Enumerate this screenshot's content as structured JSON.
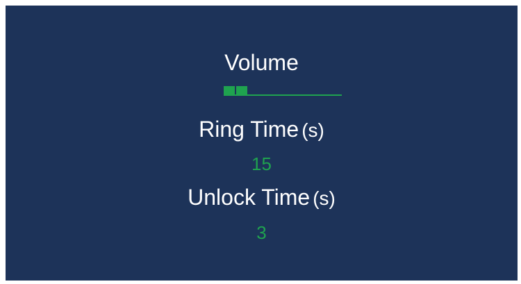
{
  "colors": {
    "background": "#1d3359",
    "label_text": "#ffffff",
    "accent": "#1fa34f"
  },
  "volume": {
    "label": "Volume",
    "level_blocks": 2,
    "level_fraction": 0.2
  },
  "ring_time": {
    "label": "Ring Time",
    "unit": "(s)",
    "value": "15"
  },
  "unlock_time": {
    "label": "Unlock Time",
    "unit": "(s)",
    "value": "3"
  }
}
